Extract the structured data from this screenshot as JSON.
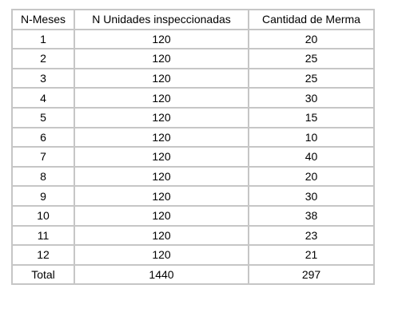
{
  "table": {
    "headers": [
      "N-Meses",
      "N Unidades inspeccionadas",
      "Cantidad de Merma"
    ],
    "rows": [
      [
        "1",
        "120",
        "20"
      ],
      [
        "2",
        "120",
        "25"
      ],
      [
        "3",
        "120",
        "25"
      ],
      [
        "4",
        "120",
        "30"
      ],
      [
        "5",
        "120",
        "15"
      ],
      [
        "6",
        "120",
        "10"
      ],
      [
        "7",
        "120",
        "40"
      ],
      [
        "8",
        "120",
        "20"
      ],
      [
        "9",
        "120",
        "30"
      ],
      [
        "10",
        "120",
        "38"
      ],
      [
        "11",
        "120",
        "23"
      ],
      [
        "12",
        "120",
        "21"
      ]
    ],
    "total": [
      "Total",
      "1440",
      "297"
    ]
  }
}
